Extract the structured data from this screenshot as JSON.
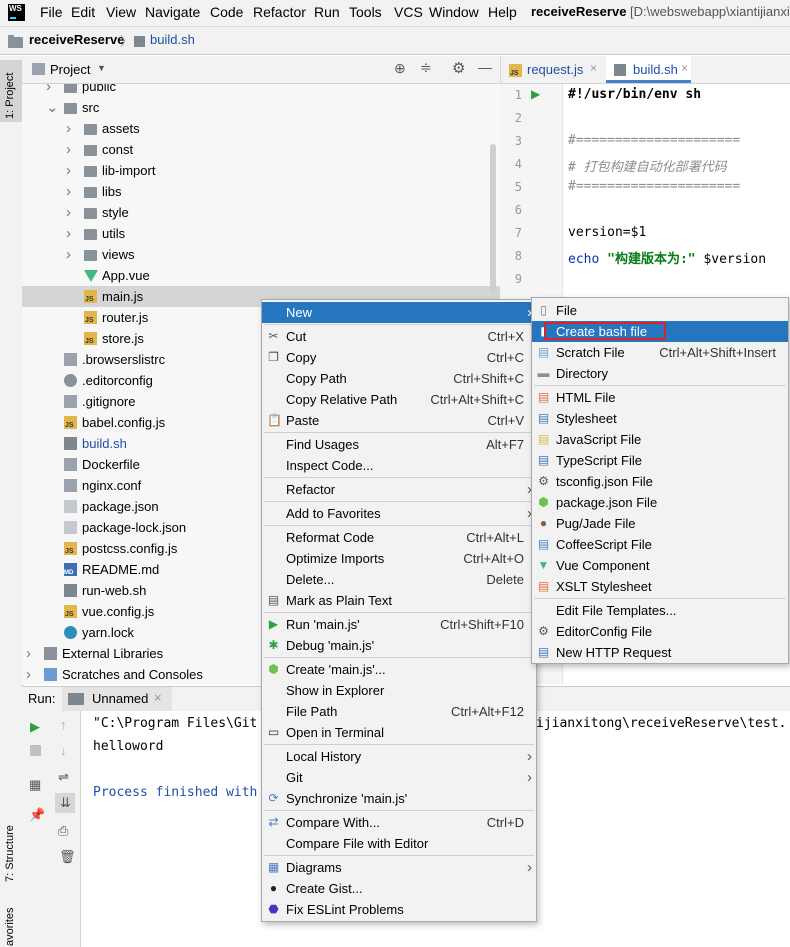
{
  "menubar": {
    "items": [
      "File",
      "Edit",
      "View",
      "Navigate",
      "Code",
      "Refactor",
      "Run",
      "Tools",
      "VCS",
      "Window",
      "Help"
    ],
    "project_name": "receiveReserve",
    "project_path": "[D:\\webswebapp\\xiantijianxit"
  },
  "breadcrumb": {
    "project": "receiveReserve",
    "file": "build.sh"
  },
  "left_strip": {
    "project_tab": "1: Project",
    "structure_tab": "7: Structure",
    "favorites_tab": "avorites"
  },
  "project_panel": {
    "title": "Project",
    "rows": [
      {
        "label": "public",
        "type": "folder",
        "indent": 1,
        "arrow": "right"
      },
      {
        "label": "src",
        "type": "folder",
        "indent": 1,
        "arrow": "down"
      },
      {
        "label": "assets",
        "type": "folder",
        "indent": 2,
        "arrow": "right"
      },
      {
        "label": "const",
        "type": "folder",
        "indent": 2,
        "arrow": "right"
      },
      {
        "label": "lib-import",
        "type": "folder",
        "indent": 2,
        "arrow": "right"
      },
      {
        "label": "libs",
        "type": "folder",
        "indent": 2,
        "arrow": "right"
      },
      {
        "label": "style",
        "type": "folder",
        "indent": 2,
        "arrow": "right"
      },
      {
        "label": "utils",
        "type": "folder",
        "indent": 2,
        "arrow": "right"
      },
      {
        "label": "views",
        "type": "folder",
        "indent": 2,
        "arrow": "right"
      },
      {
        "label": "App.vue",
        "type": "vue",
        "indent": 2,
        "arrow": ""
      },
      {
        "label": "main.js",
        "type": "js",
        "indent": 2,
        "arrow": "",
        "selected": true
      },
      {
        "label": "router.js",
        "type": "js",
        "indent": 2,
        "arrow": ""
      },
      {
        "label": "store.js",
        "type": "js",
        "indent": 2,
        "arrow": ""
      },
      {
        "label": ".browserslistrc",
        "type": "file",
        "indent": 1,
        "arrow": ""
      },
      {
        "label": ".editorconfig",
        "type": "gear",
        "indent": 1,
        "arrow": ""
      },
      {
        "label": ".gitignore",
        "type": "file",
        "indent": 1,
        "arrow": ""
      },
      {
        "label": "babel.config.js",
        "type": "js",
        "indent": 1,
        "arrow": ""
      },
      {
        "label": "build.sh",
        "type": "sh",
        "indent": 1,
        "arrow": "",
        "highlight": true
      },
      {
        "label": "Dockerfile",
        "type": "file",
        "indent": 1,
        "arrow": ""
      },
      {
        "label": "nginx.conf",
        "type": "file",
        "indent": 1,
        "arrow": ""
      },
      {
        "label": "package.json",
        "type": "json",
        "indent": 1,
        "arrow": ""
      },
      {
        "label": "package-lock.json",
        "type": "json",
        "indent": 1,
        "arrow": ""
      },
      {
        "label": "postcss.config.js",
        "type": "js",
        "indent": 1,
        "arrow": ""
      },
      {
        "label": "README.md",
        "type": "md",
        "indent": 1,
        "arrow": ""
      },
      {
        "label": "run-web.sh",
        "type": "sh",
        "indent": 1,
        "arrow": ""
      },
      {
        "label": "vue.config.js",
        "type": "js",
        "indent": 1,
        "arrow": ""
      },
      {
        "label": "yarn.lock",
        "type": "yarn",
        "indent": 1,
        "arrow": ""
      },
      {
        "label": "External Libraries",
        "type": "lib",
        "indent": 0,
        "arrow": "right"
      },
      {
        "label": "Scratches and Consoles",
        "type": "scratch",
        "indent": 0,
        "arrow": "right"
      }
    ]
  },
  "editor": {
    "tabs": [
      {
        "label": "request.js",
        "active": false
      },
      {
        "label": "build.sh",
        "active": true
      }
    ],
    "line_numbers": [
      "1",
      "2",
      "3",
      "4",
      "5",
      "6",
      "7",
      "8",
      "9"
    ],
    "lines": [
      {
        "text": "#!/usr/bin/env sh",
        "style": "bold"
      },
      {
        "text": "",
        "style": "plain"
      },
      {
        "text": "#=====================",
        "style": "comment"
      },
      {
        "text": "# 打包构建自动化部署代码",
        "style": "comment-italic"
      },
      {
        "text": "#=====================",
        "style": "comment"
      },
      {
        "text": "",
        "style": "plain"
      },
      {
        "text": "version=$1",
        "style": "plain"
      },
      {
        "text": "",
        "style": "echo"
      },
      {
        "text": "",
        "style": "plain"
      }
    ],
    "echo": {
      "keyword": "echo",
      "string": "\"构建版本为:\"",
      "var": " $version"
    }
  },
  "run_panel": {
    "label": "Run:",
    "tab": "Unnamed",
    "console_lines": [
      "\"C:\\Program Files\\Git",
      "helloword",
      "",
      "Process finished with"
    ],
    "console_tail": "ijianxitong\\receiveReserve\\test."
  },
  "context_menu": {
    "items": [
      {
        "label": "New",
        "key": "",
        "submenu": true,
        "selected": true,
        "icon": ""
      },
      {
        "sep": true
      },
      {
        "label": "Cut",
        "key": "Ctrl+X",
        "icon": "scissors-icon"
      },
      {
        "label": "Copy",
        "key": "Ctrl+C",
        "icon": "copy-icon"
      },
      {
        "label": "Copy Path",
        "key": "Ctrl+Shift+C",
        "icon": ""
      },
      {
        "label": "Copy Relative Path",
        "key": "Ctrl+Alt+Shift+C",
        "icon": ""
      },
      {
        "label": "Paste",
        "key": "Ctrl+V",
        "icon": "paste-icon"
      },
      {
        "sep": true
      },
      {
        "label": "Find Usages",
        "key": "Alt+F7",
        "icon": ""
      },
      {
        "label": "Inspect Code...",
        "key": "",
        "icon": ""
      },
      {
        "sep": true
      },
      {
        "label": "Refactor",
        "key": "",
        "submenu": true,
        "icon": ""
      },
      {
        "sep": true
      },
      {
        "label": "Add to Favorites",
        "key": "",
        "submenu": true,
        "icon": ""
      },
      {
        "sep": true
      },
      {
        "label": "Reformat Code",
        "key": "Ctrl+Alt+L",
        "icon": ""
      },
      {
        "label": "Optimize Imports",
        "key": "Ctrl+Alt+O",
        "icon": ""
      },
      {
        "label": "Delete...",
        "key": "Delete",
        "icon": ""
      },
      {
        "label": "Mark as Plain Text",
        "key": "",
        "icon": "plaintext-icon"
      },
      {
        "sep": true
      },
      {
        "label": "Run 'main.js'",
        "key": "Ctrl+Shift+F10",
        "icon": "run-icon"
      },
      {
        "label": "Debug 'main.js'",
        "key": "",
        "icon": "debug-icon"
      },
      {
        "sep": true
      },
      {
        "label": "Create 'main.js'...",
        "key": "",
        "icon": "node-icon"
      },
      {
        "label": "Show in Explorer",
        "key": "",
        "icon": ""
      },
      {
        "label": "File Path",
        "key": "Ctrl+Alt+F12",
        "icon": ""
      },
      {
        "label": "Open in Terminal",
        "key": "",
        "icon": "terminal-icon"
      },
      {
        "sep": true
      },
      {
        "label": "Local History",
        "key": "",
        "submenu": true,
        "icon": ""
      },
      {
        "label": "Git",
        "key": "",
        "submenu": true,
        "icon": ""
      },
      {
        "label": "Synchronize 'main.js'",
        "key": "",
        "icon": "sync-icon"
      },
      {
        "sep": true
      },
      {
        "label": "Compare With...",
        "key": "Ctrl+D",
        "icon": "compare-icon"
      },
      {
        "label": "Compare File with Editor",
        "key": "",
        "icon": ""
      },
      {
        "sep": true
      },
      {
        "label": "Diagrams",
        "key": "",
        "submenu": true,
        "icon": "diagram-icon"
      },
      {
        "label": "Create Gist...",
        "key": "",
        "icon": "github-icon"
      },
      {
        "label": "Fix ESLint Problems",
        "key": "",
        "icon": "eslint-icon"
      }
    ]
  },
  "new_submenu": {
    "items": [
      {
        "label": "File",
        "key": "",
        "icon": "file-icon"
      },
      {
        "label": "Create bash file",
        "key": "",
        "icon": "bash-icon",
        "selected": true
      },
      {
        "label": "Scratch File",
        "key": "Ctrl+Alt+Shift+Insert",
        "icon": "scratch-icon"
      },
      {
        "label": "Directory",
        "key": "",
        "icon": "folder-icon"
      },
      {
        "sep": true
      },
      {
        "label": "HTML File",
        "key": "",
        "icon": "html-icon"
      },
      {
        "label": "Stylesheet",
        "key": "",
        "icon": "css-icon"
      },
      {
        "label": "JavaScript File",
        "key": "",
        "icon": "js-icon"
      },
      {
        "label": "TypeScript File",
        "key": "",
        "icon": "ts-icon"
      },
      {
        "label": "tsconfig.json File",
        "key": "",
        "icon": "tsconfig-icon"
      },
      {
        "label": "package.json File",
        "key": "",
        "icon": "node-icon"
      },
      {
        "label": "Pug/Jade File",
        "key": "",
        "icon": "pug-icon"
      },
      {
        "label": "CoffeeScript File",
        "key": "",
        "icon": "coffee-icon"
      },
      {
        "label": "Vue Component",
        "key": "",
        "icon": "vue-icon"
      },
      {
        "label": "XSLT Stylesheet",
        "key": "",
        "icon": "xslt-icon"
      },
      {
        "sep": true
      },
      {
        "label": "Edit File Templates...",
        "key": "",
        "icon": ""
      },
      {
        "label": "EditorConfig File",
        "key": "",
        "icon": "gear-icon"
      },
      {
        "label": "New HTTP Request",
        "key": "",
        "icon": "api-icon"
      }
    ]
  },
  "colors": {
    "selection": "#2675bf",
    "highlight_box": "#e0202a",
    "code_green": "#067d17",
    "code_blue": "#0033b3",
    "comment": "#8c8c8c"
  }
}
